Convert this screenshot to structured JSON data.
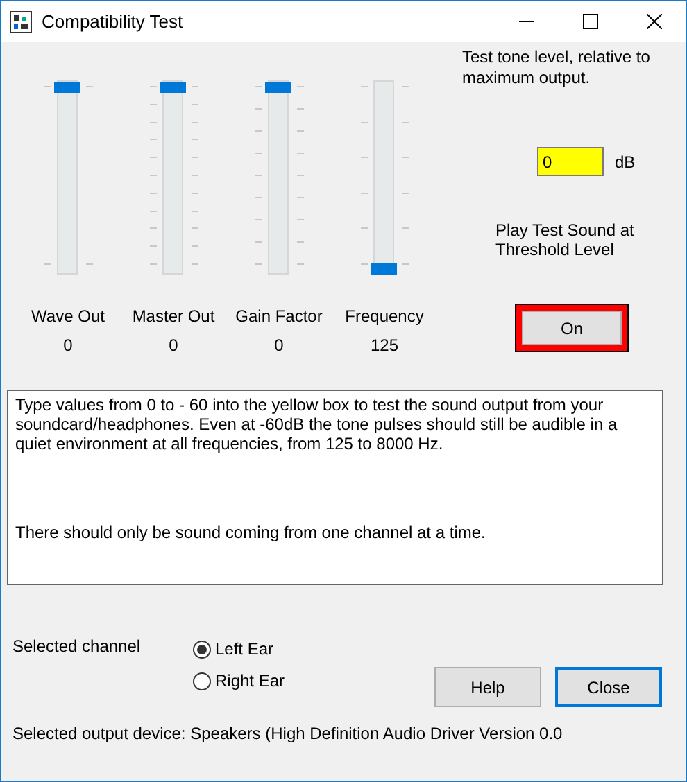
{
  "window": {
    "title": "Compatibility Test"
  },
  "sliders": [
    {
      "label": "Wave Out",
      "value": "0",
      "level": 1
    },
    {
      "label": "Master Out",
      "value": "0",
      "level": 1
    },
    {
      "label": "Gain Factor",
      "value": "0",
      "level": 1
    },
    {
      "label": "Frequency",
      "value": "125",
      "level": 0
    }
  ],
  "level_panel": {
    "description": "Test tone level, relative to maximum output.",
    "field_value": "0",
    "unit": "dB",
    "play_label": "Play Test Sound at Threshold Level",
    "play_button": "On"
  },
  "info_text": [
    "Type values from 0 to - 60 into the yellow box to test the sound output from your soundcard/headphones. Even at -60dB the tone pulses should still be audible in a quiet environment at all frequencies, from 125 to 8000 Hz.",
    "There should only be sound coming from one channel at a time."
  ],
  "channel": {
    "label": "Selected channel",
    "options": [
      {
        "label": "Left Ear",
        "selected": true
      },
      {
        "label": "Right Ear",
        "selected": false
      }
    ]
  },
  "buttons": [
    "Help",
    "Close"
  ],
  "status": "Selected output device: Speakers (High Definition Audio Driver Version 0.0"
}
